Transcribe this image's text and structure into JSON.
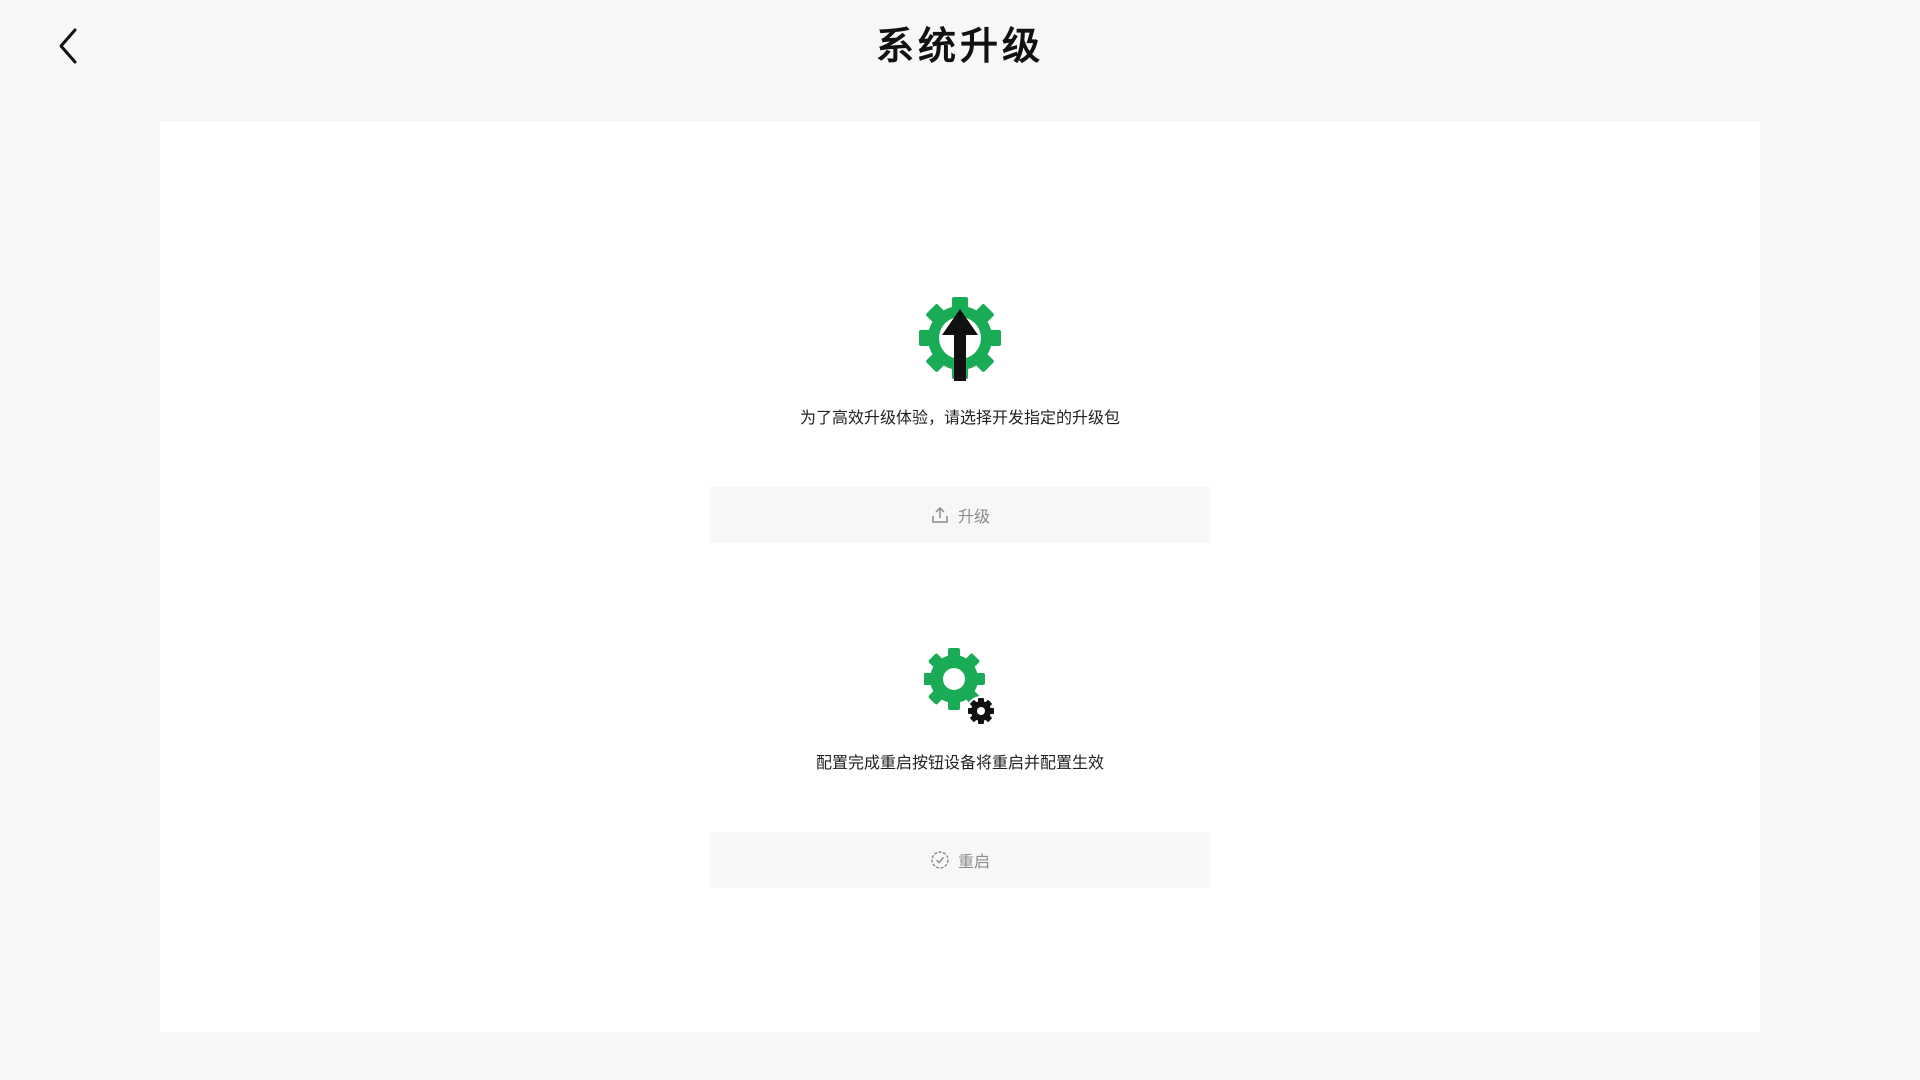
{
  "header": {
    "back_icon": "chevron-left-icon",
    "title": "系统升级"
  },
  "upgrade": {
    "icon": "gear-upload-icon",
    "description": "为了高效升级体验，请选择开发指定的升级包",
    "button_icon": "upload-icon",
    "button_label": "升级"
  },
  "restart": {
    "icon": "gears-icon",
    "description": "配置完成重启按钮设备将重启并配置生效",
    "button_icon": "check-badge-icon",
    "button_label": "重启"
  },
  "colors": {
    "accent_green": "#1aab56",
    "background": "#f7f7f7",
    "card": "#ffffff",
    "disabled_text": "#8c8c8c"
  }
}
